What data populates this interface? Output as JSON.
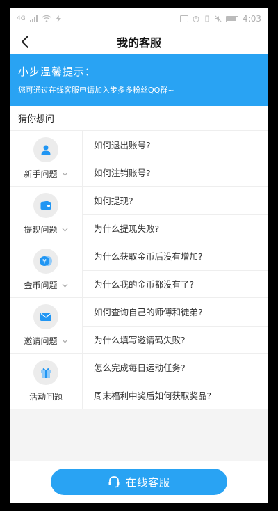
{
  "status_bar": {
    "carrier": "4G",
    "time": "4:03"
  },
  "nav": {
    "title": "我的客服"
  },
  "banner": {
    "title": "小步温馨提示：",
    "text": "您可通过在线客服申请加入步多多粉丝QQ群~"
  },
  "guess": {
    "label": "猜你想问"
  },
  "categories": [
    {
      "label": "新手问题",
      "icon": "user-icon",
      "questions": [
        "如何退出账号?",
        "如何注销账号?"
      ]
    },
    {
      "label": "提现问题",
      "icon": "wallet-icon",
      "questions": [
        "如何提现?",
        "为什么提现失败?"
      ]
    },
    {
      "label": "金币问题",
      "icon": "coin-icon",
      "questions": [
        "为什么获取金币后没有增加?",
        "为什么我的金币都没有了?"
      ]
    },
    {
      "label": "邀请问题",
      "icon": "mail-icon",
      "questions": [
        "如何查询自己的师傅和徒弟?",
        "为什么填写邀请码失败?"
      ]
    },
    {
      "label": "活动问题",
      "icon": "gift-icon",
      "questions": [
        "怎么完成每日运动任务?",
        "周末福利中奖后如何获取奖品?"
      ]
    }
  ],
  "bottom": {
    "service_label": "在线客服"
  },
  "colors": {
    "accent": "#29a3f3",
    "icon": "#2196f3"
  }
}
